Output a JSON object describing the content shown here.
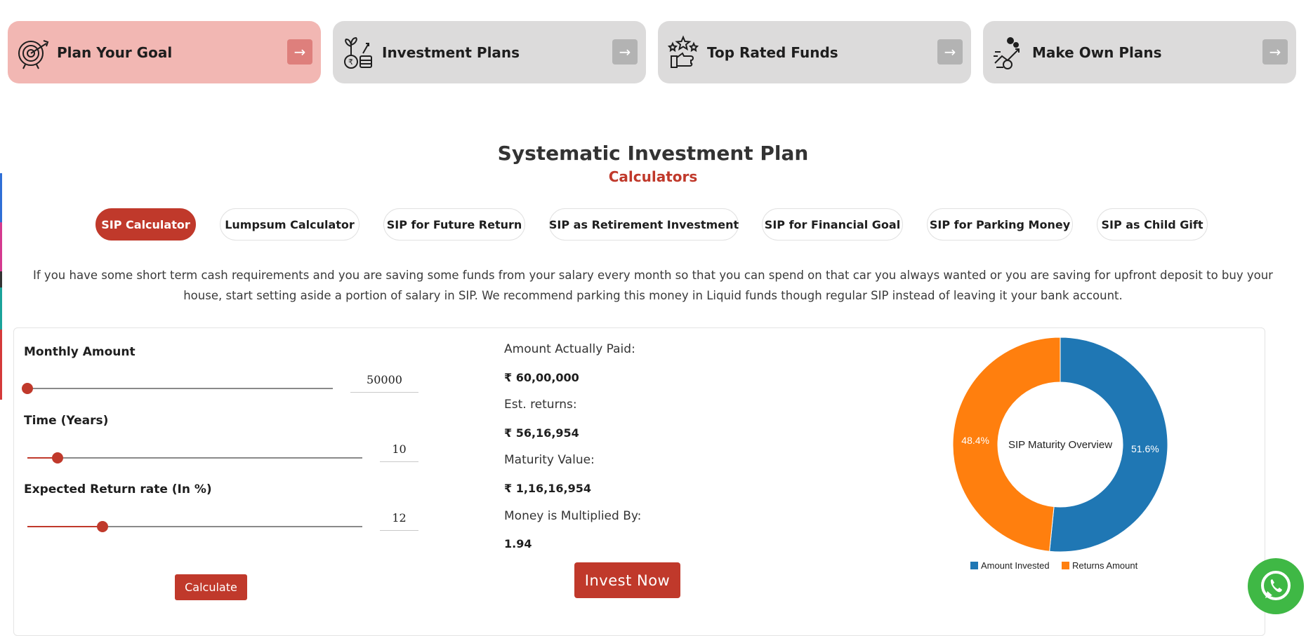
{
  "nav_cards": [
    {
      "title": "Plan Your Goal",
      "icon": "target-icon",
      "active": true
    },
    {
      "title": "Investment Plans",
      "icon": "money-growth-icon",
      "active": false
    },
    {
      "title": "Top Rated Funds",
      "icon": "rating-stars-icon",
      "active": false
    },
    {
      "title": "Make Own Plans",
      "icon": "plan-chart-icon",
      "active": false
    }
  ],
  "arrow_glyph": "→",
  "header": {
    "title": "Systematic Investment Plan",
    "subtitle": "Calculators"
  },
  "tabs": [
    {
      "label": "SIP Calculator",
      "active": true
    },
    {
      "label": "Lumpsum Calculator",
      "active": false
    },
    {
      "label": "SIP for Future Return",
      "active": false
    },
    {
      "label": "SIP as Retirement Investment",
      "active": false
    },
    {
      "label": "SIP for Financial Goal",
      "active": false
    },
    {
      "label": "SIP for Parking Money",
      "active": false
    },
    {
      "label": "SIP as Child Gift",
      "active": false
    }
  ],
  "description": "If you have some short term cash requirements and you are saving some funds from your salary every month so that you can spend on that car you always wanted or you are saving for upfront deposit to buy your house, start setting aside a portion of salary in SIP. We recommend parking this money in Liquid funds though regular SIP instead of leaving it your bank account.",
  "form": {
    "monthly_amount": {
      "label": "Monthly Amount",
      "value": "50000",
      "slider_fraction": 0.0
    },
    "time_years": {
      "label": "Time (Years)",
      "value": "10",
      "slider_fraction": 0.09
    },
    "return_rate": {
      "label": "Expected Return rate (In %)",
      "value": "12",
      "slider_fraction": 0.225
    },
    "calculate_label": "Calculate"
  },
  "results": {
    "amount_paid_label": "Amount Actually Paid:",
    "amount_paid_value": "₹ 60,00,000",
    "est_returns_label": "Est. returns:",
    "est_returns_value": "₹ 56,16,954",
    "maturity_label": "Maturity Value:",
    "maturity_value": "₹ 1,16,16,954",
    "multiplier_label": "Money is Multiplied By:",
    "multiplier_value": "1.94",
    "invest_label": "Invest Now"
  },
  "chart_data": {
    "type": "pie",
    "title": "SIP Maturity Overview",
    "categories": [
      "Amount Invested",
      "Returns Amount"
    ],
    "values": [
      51.6,
      48.4
    ],
    "data_labels": [
      "51.6%",
      "48.4%"
    ],
    "colors": [
      "#1f77b4",
      "#ff7f0e"
    ],
    "legend": "bottom",
    "donut": true
  },
  "colors": {
    "accent": "#c0392b",
    "active_card": "#f2b7b3",
    "card": "#dcdbdb",
    "whatsapp": "#3fb845"
  },
  "whatsapp": {
    "icon": "whatsapp-icon"
  }
}
